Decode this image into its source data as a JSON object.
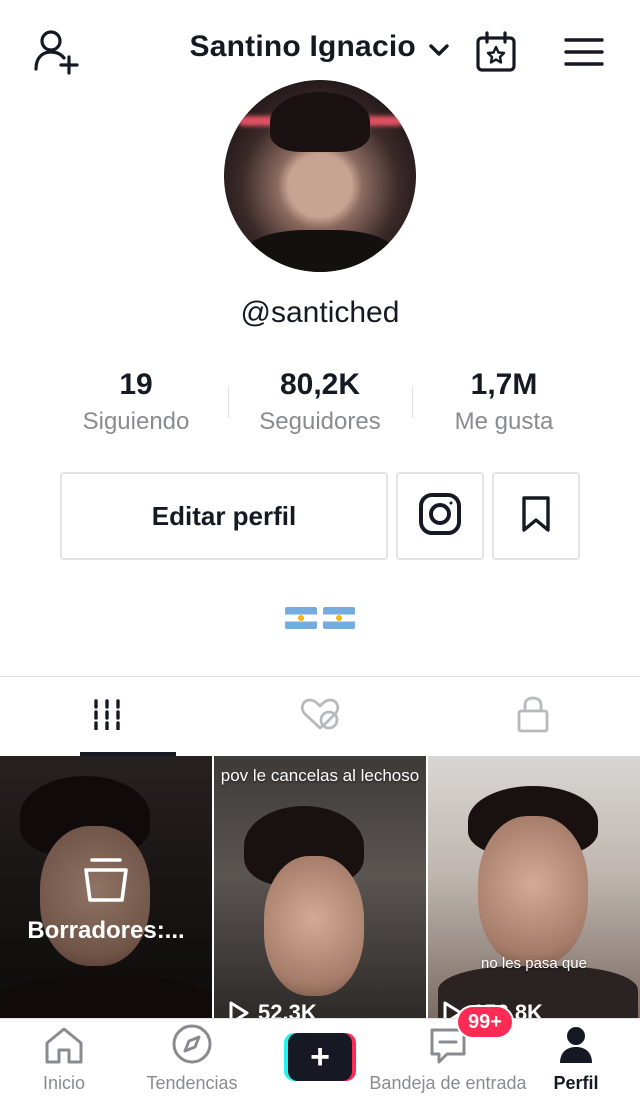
{
  "header": {
    "title": "Santino Ignacio",
    "icons": {
      "add_user": "add-user-icon",
      "title_dropdown": "chevron-down-icon",
      "calendar": "calendar-star-icon",
      "menu": "menu-icon"
    }
  },
  "profile": {
    "avatar": "avatar",
    "username": "@santiched",
    "stats": [
      {
        "value": "19",
        "label": "Siguiendo"
      },
      {
        "value": "80,2K",
        "label": "Seguidores"
      },
      {
        "value": "1,7M",
        "label": "Me gusta"
      }
    ],
    "edit_button": "Editar perfil",
    "instagram_icon": "instagram-icon",
    "favorites_icon": "bookmark-icon",
    "bio_flags": [
      "argentina-flag",
      "argentina-flag"
    ]
  },
  "tabs": [
    {
      "icon": "grid-icon",
      "active": true
    },
    {
      "icon": "liked-hidden-icon",
      "active": false
    },
    {
      "icon": "lock-icon",
      "active": false
    }
  ],
  "videos": [
    {
      "type": "drafts",
      "label": "Borradores:...",
      "icon": "drafts-icon"
    },
    {
      "caption": "pov le cancelas al lechoso",
      "views": "52,3K"
    },
    {
      "caption": "no les pasa que",
      "views": "156,8K"
    }
  ],
  "nav": {
    "items": [
      {
        "label": "Inicio",
        "icon": "home-icon"
      },
      {
        "label": "Tendencias",
        "icon": "compass-icon"
      },
      {
        "label": "",
        "icon": "create-plus-icon"
      },
      {
        "label": "Bandeja de entrada",
        "icon": "inbox-icon",
        "badge": "99+"
      },
      {
        "label": "Perfil",
        "icon": "profile-icon",
        "active": true
      }
    ]
  },
  "colors": {
    "text": "#161823",
    "muted": "#8a8b91",
    "border": "#e3e3e4",
    "accent_red": "#fe2c55",
    "accent_cyan": "#25f4ee"
  }
}
